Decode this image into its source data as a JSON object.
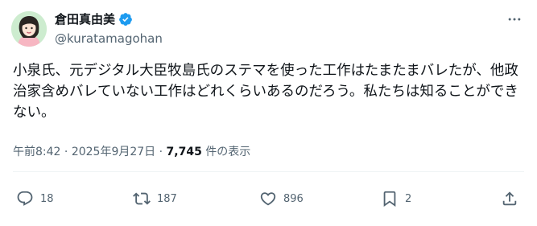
{
  "author": {
    "display_name": "倉田真由美",
    "handle": "@kuratamagohan",
    "verified_icon": "verified-badge-icon",
    "avatar_icon": "avatar-illustration"
  },
  "tweet": {
    "text": "小泉氏、元デジタル大臣牧島氏のステマを使った工作はたまたまバレたが、他政治家含めバレていない工作はどれくらいあるのだろう。私たちは知ることができない。",
    "time": "午前8:42",
    "separator": "·",
    "date": "2025年9月27日",
    "views_count": "7,745",
    "views_label": "件の表示"
  },
  "actions": {
    "reply_count": "18",
    "retweet_count": "187",
    "like_count": "896",
    "bookmark_count": "2"
  },
  "colors": {
    "verified": "#1d9bf0",
    "secondary_text": "#536471",
    "primary_text": "#0f1419",
    "avatar_bg": "#cdeccf"
  }
}
